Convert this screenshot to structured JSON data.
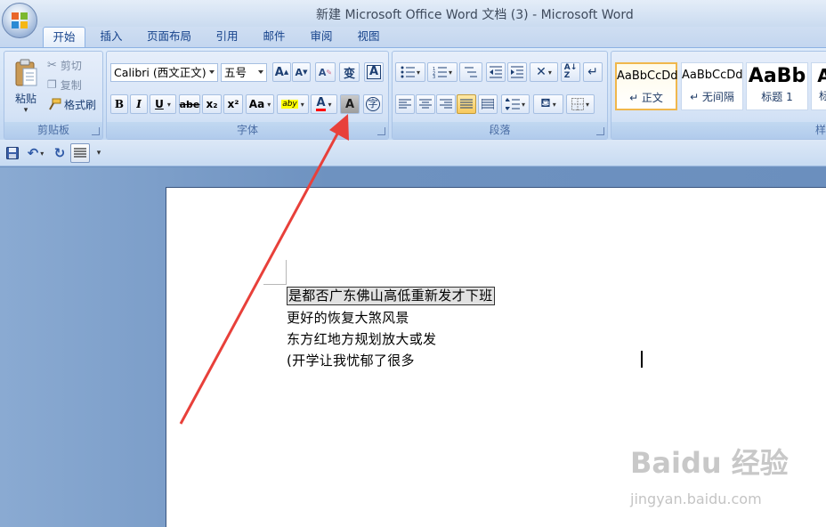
{
  "window": {
    "title": "新建 Microsoft Office Word 文档 (3) - Microsoft Word"
  },
  "tabs": [
    "开始",
    "插入",
    "页面布局",
    "引用",
    "邮件",
    "审阅",
    "视图"
  ],
  "clipboard": {
    "paste": "粘贴",
    "cut": "剪切",
    "copy": "复制",
    "format_painter": "格式刷",
    "label": "剪贴板"
  },
  "font": {
    "name": "Calibri (西文正文)",
    "size": "五号",
    "grow": "A",
    "shrink": "A",
    "clear": "A",
    "phonetic": "变",
    "border": "A",
    "bold": "B",
    "italic": "I",
    "underline": "U",
    "strike": "abe",
    "subscript": "x₂",
    "superscript": "x²",
    "case": "Aa",
    "highlight": "aby",
    "color": "A",
    "shading": "A",
    "enclose": "字",
    "label": "字体"
  },
  "paragraph": {
    "label": "段落"
  },
  "styles": {
    "items": [
      {
        "preview": "AaBbCcDd",
        "name": "↵ 正文"
      },
      {
        "preview": "AaBbCcDd",
        "name": "↵ 无间隔"
      },
      {
        "preview": "AaBb",
        "name": "标题 1"
      },
      {
        "preview": "A",
        "name": "标"
      }
    ],
    "label": "样"
  },
  "document": {
    "lines": [
      "是都否广东佛山高低重新发才下班",
      "更好的恢复大煞风景",
      "东方红地方规划放大或发",
      "(开学让我忧郁了很多"
    ]
  },
  "watermark": {
    "brand": "Baidu 经验",
    "url": "jingyan.baidu.com"
  },
  "colors": {
    "arrow": "#e8403a",
    "highlight_yellow": "#ffff00",
    "font_red": "#ff0000"
  }
}
